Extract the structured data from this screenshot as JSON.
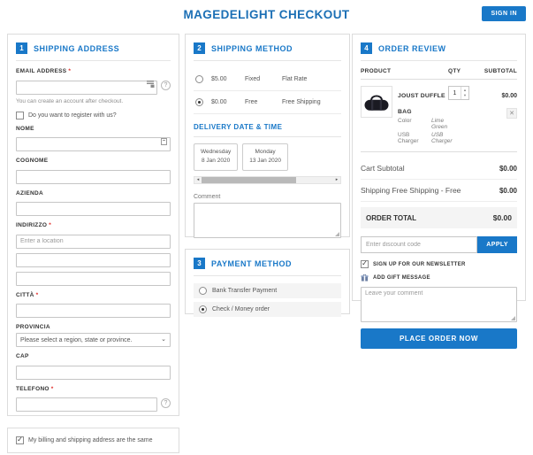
{
  "header": {
    "title": "MAGEDELIGHT CHECKOUT",
    "sign_in_label": "SIGN IN"
  },
  "shipping_address": {
    "step": "1",
    "title": "SHIPPING ADDRESS",
    "email": {
      "label": "EMAIL ADDRESS",
      "note": "You can create an account after checkout."
    },
    "register_label": "Do you want to register with us?",
    "nome_label": "NOME",
    "cognome_label": "COGNOME",
    "azienda_label": "AZIENDA",
    "indirizzo": {
      "label": "INDIRIZZO",
      "placeholder": "Enter a location"
    },
    "citta_label": "CITTÀ",
    "provincia": {
      "label": "PROVINCIA",
      "selected_option": "Please select a region, state or province."
    },
    "cap_label": "CAP",
    "telefono_label": "TELEFONO",
    "billing_same_label": "My billing and shipping address are the same"
  },
  "shipping_method": {
    "step": "2",
    "title": "SHIPPING METHOD",
    "options": [
      {
        "price": "$5.00",
        "method": "Fixed",
        "carrier": "Flat Rate",
        "selected": false
      },
      {
        "price": "$0.00",
        "method": "Free",
        "carrier": "Free Shipping",
        "selected": true
      }
    ],
    "delivery": {
      "title": "DELIVERY DATE & TIME",
      "dates": [
        {
          "day": "Wednesday",
          "date": "8 Jan 2020"
        },
        {
          "day": "Monday",
          "date": "13 Jan 2020"
        }
      ]
    },
    "comment_label": "Comment"
  },
  "payment_method": {
    "step": "3",
    "title": "PAYMENT METHOD",
    "options": [
      {
        "label": "Bank Transfer Payment",
        "selected": false
      },
      {
        "label": "Check / Money order",
        "selected": true
      }
    ]
  },
  "order_review": {
    "step": "4",
    "title": "ORDER REVIEW",
    "columns": {
      "product": "PRODUCT",
      "qty": "QTY",
      "subtotal": "SUBTOTAL"
    },
    "item": {
      "name": "JOUST DUFFLE BAG",
      "attributes": [
        {
          "label": "Color",
          "value": "Lime Green"
        },
        {
          "label": "USB Charger",
          "value": "USB Charger"
        }
      ],
      "qty": "1",
      "subtotal": "$0.00"
    },
    "totals": [
      {
        "label": "Cart Subtotal",
        "value": "$0.00"
      },
      {
        "label": "Shipping Free Shipping - Free",
        "value": "$0.00"
      }
    ],
    "order_total": {
      "label": "ORDER TOTAL",
      "value": "$0.00"
    },
    "discount": {
      "placeholder": "Enter discount code",
      "apply_label": "APPLY"
    },
    "newsletter_label": "SIGN UP FOR OUR NEWSLETTER",
    "gift_label": "ADD GIFT MESSAGE",
    "comment_placeholder": "Leave your comment",
    "place_order_label": "PLACE ORDER NOW"
  },
  "colors": {
    "accent": "#1978c8",
    "required": "#e02b27"
  }
}
